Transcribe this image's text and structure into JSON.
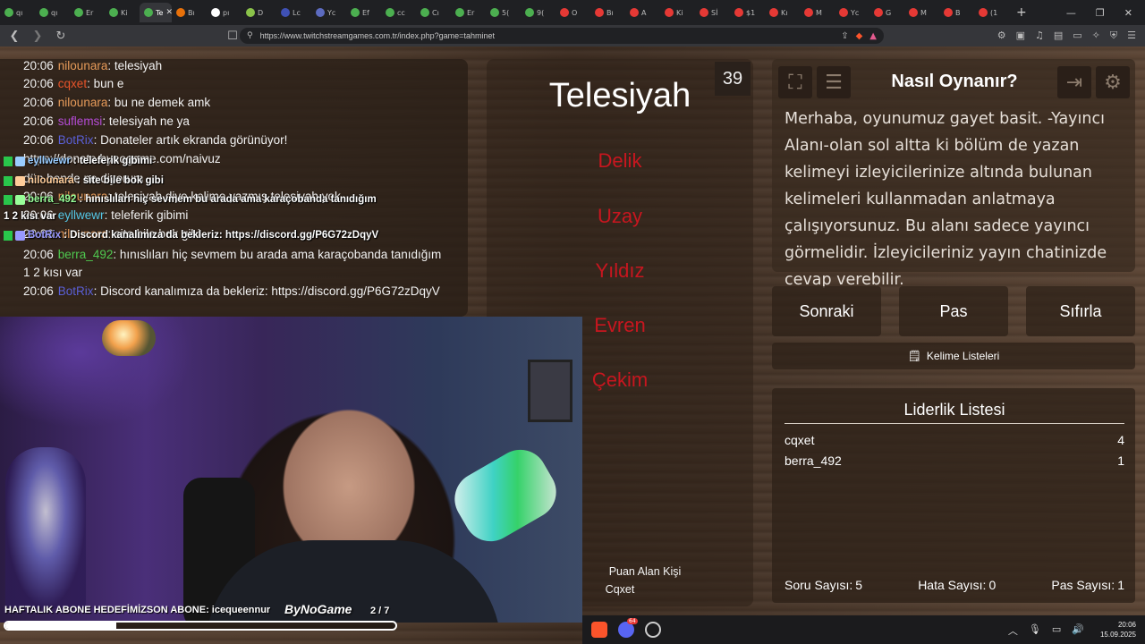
{
  "browser": {
    "tabs": [
      {
        "label": "qı",
        "color": "#4caf50"
      },
      {
        "label": "qı",
        "color": "#4caf50"
      },
      {
        "label": "Er",
        "color": "#4caf50"
      },
      {
        "label": "Ki",
        "color": "#4caf50"
      },
      {
        "label": "Te",
        "color": "#4caf50",
        "active": true
      },
      {
        "label": "Bı",
        "color": "#e8710a"
      },
      {
        "label": "pı",
        "color": "#ffffff"
      },
      {
        "label": "D",
        "color": "#8bc34a"
      },
      {
        "label": "Lc",
        "color": "#3f51b5"
      },
      {
        "label": "Yc",
        "color": "#5c6bc0"
      },
      {
        "label": "Ef",
        "color": "#4caf50"
      },
      {
        "label": "cc",
        "color": "#4caf50"
      },
      {
        "label": "Cı",
        "color": "#4caf50"
      },
      {
        "label": "Er",
        "color": "#4caf50"
      },
      {
        "label": "5(",
        "color": "#4caf50"
      },
      {
        "label": "9(",
        "color": "#4caf50"
      },
      {
        "label": "O",
        "color": "#e53935"
      },
      {
        "label": "Bı",
        "color": "#e53935"
      },
      {
        "label": "A",
        "color": "#e53935"
      },
      {
        "label": "Ki",
        "color": "#e53935"
      },
      {
        "label": "Sİ",
        "color": "#e53935"
      },
      {
        "label": "$1",
        "color": "#e53935"
      },
      {
        "label": "Kı",
        "color": "#e53935"
      },
      {
        "label": "M",
        "color": "#e53935"
      },
      {
        "label": "Yc",
        "color": "#e53935"
      },
      {
        "label": "G",
        "color": "#e53935"
      },
      {
        "label": "M",
        "color": "#e53935"
      },
      {
        "label": "B",
        "color": "#e53935"
      },
      {
        "label": "(1",
        "color": "#e53935"
      }
    ],
    "active_tab_close": "✕",
    "new_tab": "+",
    "window_controls": {
      "minimize": "—",
      "maximize": "❐",
      "close": "✕"
    },
    "url": "https://www.twitchstreamgames.com.tr/index.php?game=tahminet"
  },
  "chat": {
    "lines": [
      {
        "time": "20:06",
        "user": "nilounara",
        "color": "#e79b5a",
        "text": ": telesiyah"
      },
      {
        "time": "20:06",
        "user": "cqxet",
        "color": "#e8542a",
        "text": ": bun e"
      },
      {
        "time": "20:06",
        "user": "nilounara",
        "color": "#e79b5a",
        "text": ": bu ne demek amk"
      },
      {
        "time": "20:06",
        "user": "suflemsi",
        "color": "#b44bd6",
        "text": ": telesiyah ne ya"
      },
      {
        "time": "20:06",
        "user": "BotRix",
        "color": "#5a5fd6",
        "text": ": Donateler artık ekranda görünüyor!"
      },
      {
        "time": "",
        "user": "",
        "color": "#f2f2f2",
        "text": "https://donate.bynogame.com/naivuz"
      },
      {
        "time": "",
        "user": "",
        "color": "#f2f2f2",
        "text": "dün bende ne diyorum"
      },
      {
        "time": "20:06",
        "user": "nilounara",
        "color": "#e79b5a",
        "text": ": telesiyah diye kelime yazmış telesiyah yok"
      },
      {
        "time": "20:06",
        "user": "eyllwewr",
        "color": "#54c7e6",
        "text": ": teleferik gibimi"
      },
      {
        "time": "20:06",
        "user": "nilounara",
        "color": "#e79b5a",
        "text": ": site bile bok gibi"
      },
      {
        "time": "20:06",
        "user": "berra_492",
        "color": "#4fc94f",
        "text": ": hınıslıları hiç sevmem bu arada ama karaçobanda tanıdığım"
      },
      {
        "time": "",
        "user": "",
        "color": "#f2f2f2",
        "text": "1 2 kısı var"
      },
      {
        "time": "20:06",
        "user": "BotRix",
        "color": "#5a5fd6",
        "text": ": Discord kanalımıza da bekleriz: https://discord.gg/P6G72zDqyV"
      }
    ]
  },
  "overlay_chat": [
    {
      "user": "eyllwewr",
      "text": ": teleferik gibimi",
      "color": "#9cf"
    },
    {
      "user": "nilounara",
      "text": ": site bile bok gibi",
      "color": "#fc9"
    },
    {
      "user": "berra_492",
      "text": ": hınıslıları hiç sevmem bu arada ama karaçobanda tanıdığım",
      "color": "#9f9"
    },
    {
      "user": "1 2 kısı var",
      "text": "",
      "color": "#fff"
    },
    {
      "user": "BotRix",
      "text": ": Discord kanalımıza da bekleriz: https://discord.gg/P6G72zDqyV",
      "color": "#99f"
    }
  ],
  "stream_overlay": {
    "sub_goal_text": "HAFTALIK ABONE HEDEFİMİZSON ABONE: icequeennur",
    "sponsor": "ByNoGame",
    "progress_label": "2 / 7",
    "progress_fraction": 0.285
  },
  "game": {
    "timer": "39",
    "word": "Telesiyah",
    "forbidden_words": [
      "Delik",
      "Uzay",
      "Yıldız",
      "Evren",
      "Çekim"
    ],
    "scorer_label": "Puan Alan Kişi",
    "scorer_name": "Cqxet"
  },
  "help": {
    "title": "Nasıl Oynanır?",
    "text": "Merhaba, oyunumuz gayet basit. -Yayıncı Alanı-olan sol altta ki bölüm de yazan kelimeyi izleyicilerinize altında bulunan kelimeleri kullanmadan anlatmaya çalışıyorsunuz. Bu alanı sadece yayıncı görmelidir. İzleyicileriniz yayın chatinizde cevap verebilir."
  },
  "actions": {
    "next": "Sonraki",
    "pass": "Pas",
    "reset": "Sıfırla",
    "word_lists": "Kelime Listeleri"
  },
  "leaderboard": {
    "title": "Liderlik Listesi",
    "rows": [
      {
        "name": "cqxet",
        "score": "4"
      },
      {
        "name": "berra_492",
        "score": "1"
      }
    ],
    "stats": {
      "questions_label": "Soru Sayısı:",
      "questions": "5",
      "errors_label": "Hata Sayısı:",
      "errors": "0",
      "passes_label": "Pas Sayısı:",
      "passes": "1"
    }
  },
  "taskbar": {
    "time": "20:06",
    "date": "15.09.2025",
    "discord_badge": "64"
  },
  "colors": {
    "forbidden": "#c8161f",
    "accent_green": "#29c64b"
  }
}
